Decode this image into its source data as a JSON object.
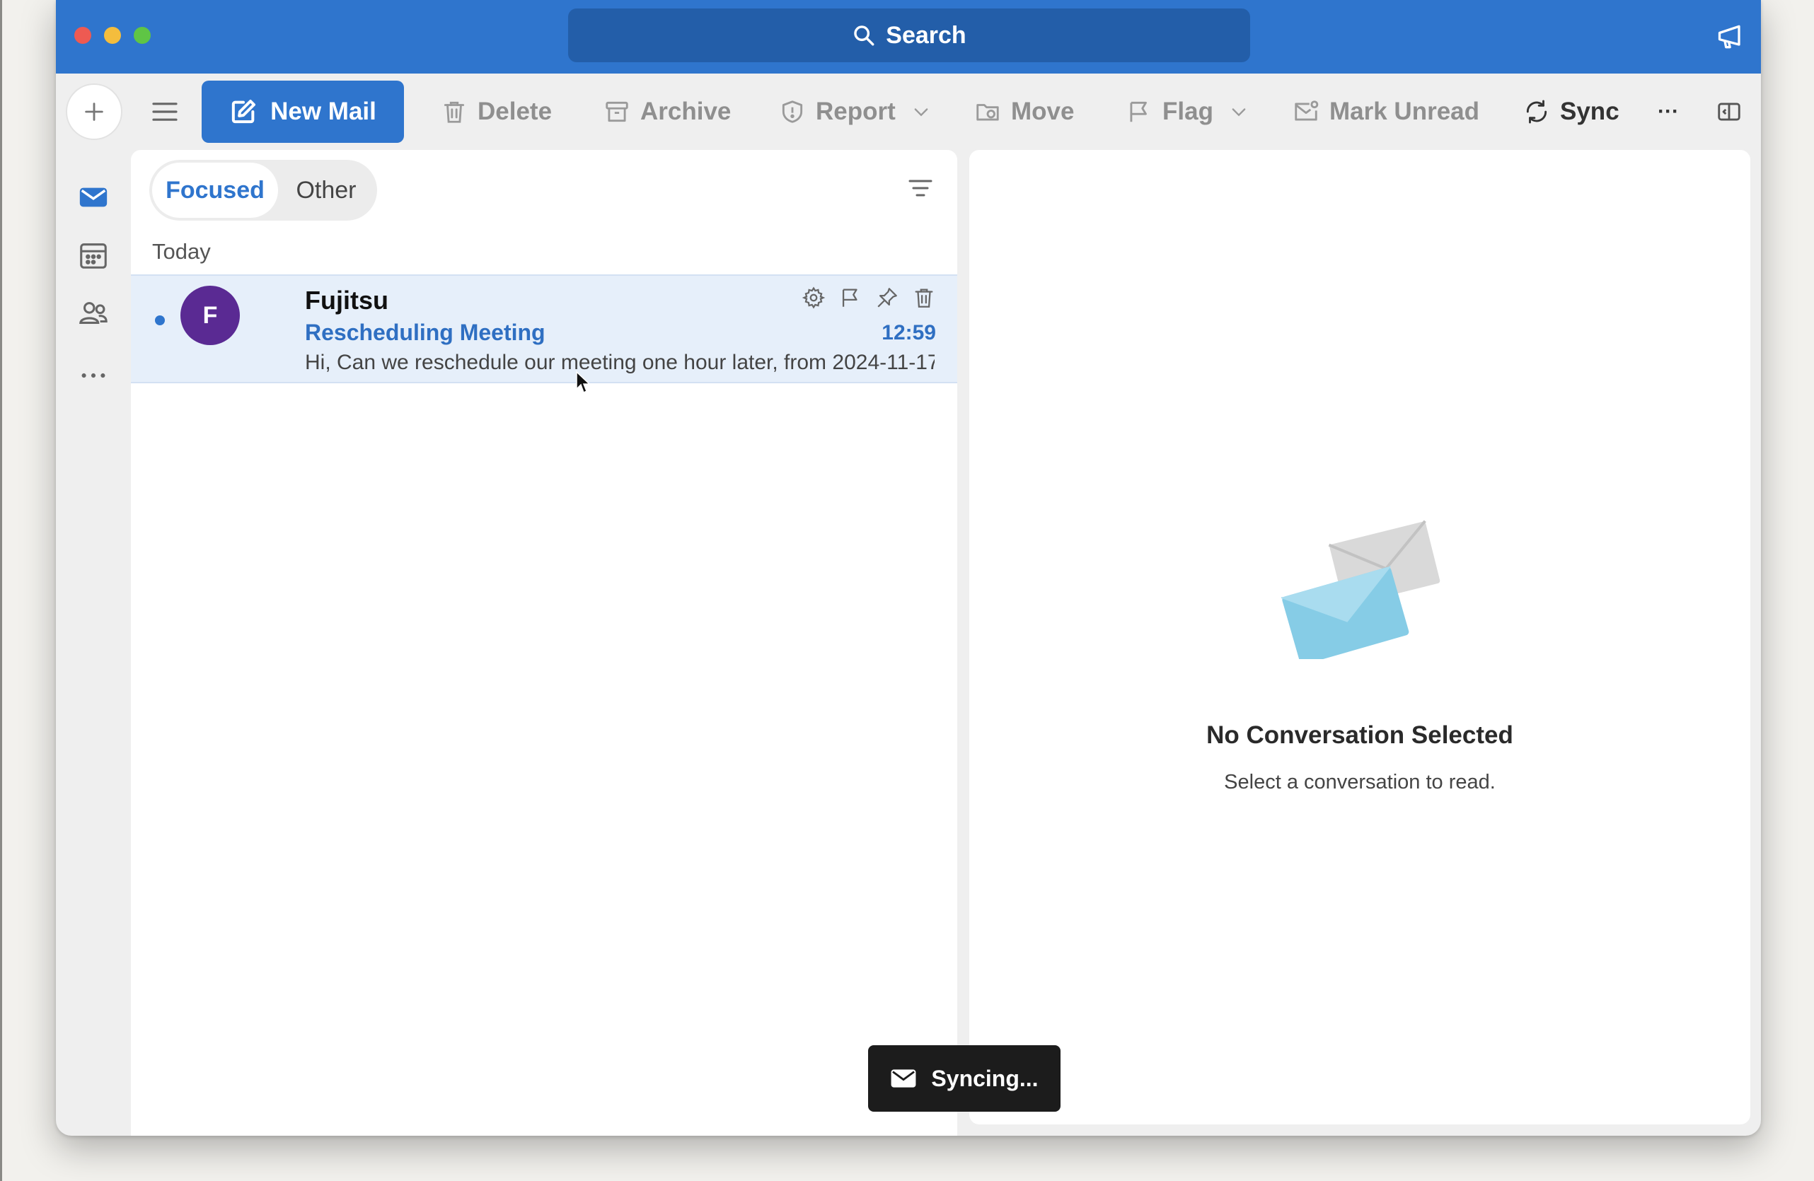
{
  "window": {
    "search_label": "Search"
  },
  "toolbar": {
    "new_mail": "New Mail",
    "delete": "Delete",
    "archive": "Archive",
    "report": "Report",
    "move": "Move",
    "flag": "Flag",
    "mark_unread": "Mark Unread",
    "sync": "Sync",
    "more": "···"
  },
  "list": {
    "tabs": {
      "focused": "Focused",
      "other": "Other"
    },
    "group_label": "Today",
    "messages": [
      {
        "sender": "Fujitsu",
        "avatar_letter": "F",
        "avatar_color": "#5a2a93",
        "subject": "Rescheduling Meeting",
        "preview": "Hi, Can we reschedule our meeting one hour later, from 2024-11-17 1...",
        "time": "12:59",
        "unread": true
      }
    ]
  },
  "reading_pane": {
    "title": "No Conversation Selected",
    "subtitle": "Select a conversation to read."
  },
  "toast": {
    "text": "Syncing..."
  },
  "theme": {
    "accent": "#2f75cd",
    "selected_row": "#e6effa"
  }
}
